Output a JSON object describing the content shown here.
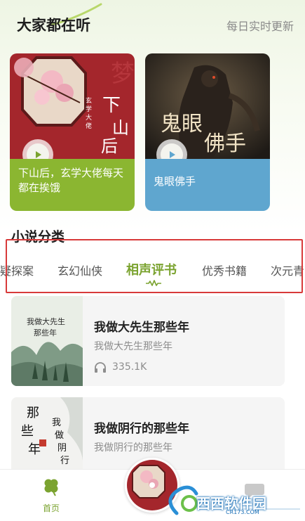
{
  "header": {
    "title": "大家都在听",
    "subtitle": "每日实时更新"
  },
  "featured": [
    {
      "caption": "下山后，玄学大佬每天都在挨饿",
      "cover_text": "下山后",
      "cover_small_text": "玄学大佬每天都在挨饿"
    },
    {
      "caption": "鬼眼佛手",
      "cover_text": "鬼眼佛手"
    }
  ],
  "categories": {
    "title": "小说分类",
    "tabs": [
      "疑探案",
      "玄幻仙侠",
      "相声评书",
      "优秀书籍",
      "次元青"
    ],
    "active_index": 2
  },
  "books": [
    {
      "title": "我做大先生那些年",
      "subtitle": "我做大先生那些年",
      "plays": "335.1K",
      "cover_text": "我做大先生那些年"
    },
    {
      "title": "我做阴行的那些年",
      "subtitle": "我做阴行的那些年",
      "cover_text": "那些年 我做阴行"
    }
  ],
  "bottom_nav": {
    "home_label": "首页"
  },
  "watermark": {
    "text": "西西软件园",
    "url": "CR173.COM"
  },
  "colors": {
    "accent_green": "#7ba330",
    "card1_caption": "#8bb631",
    "card2_caption": "#5fa6cf",
    "highlight_red": "#d83a3a"
  }
}
